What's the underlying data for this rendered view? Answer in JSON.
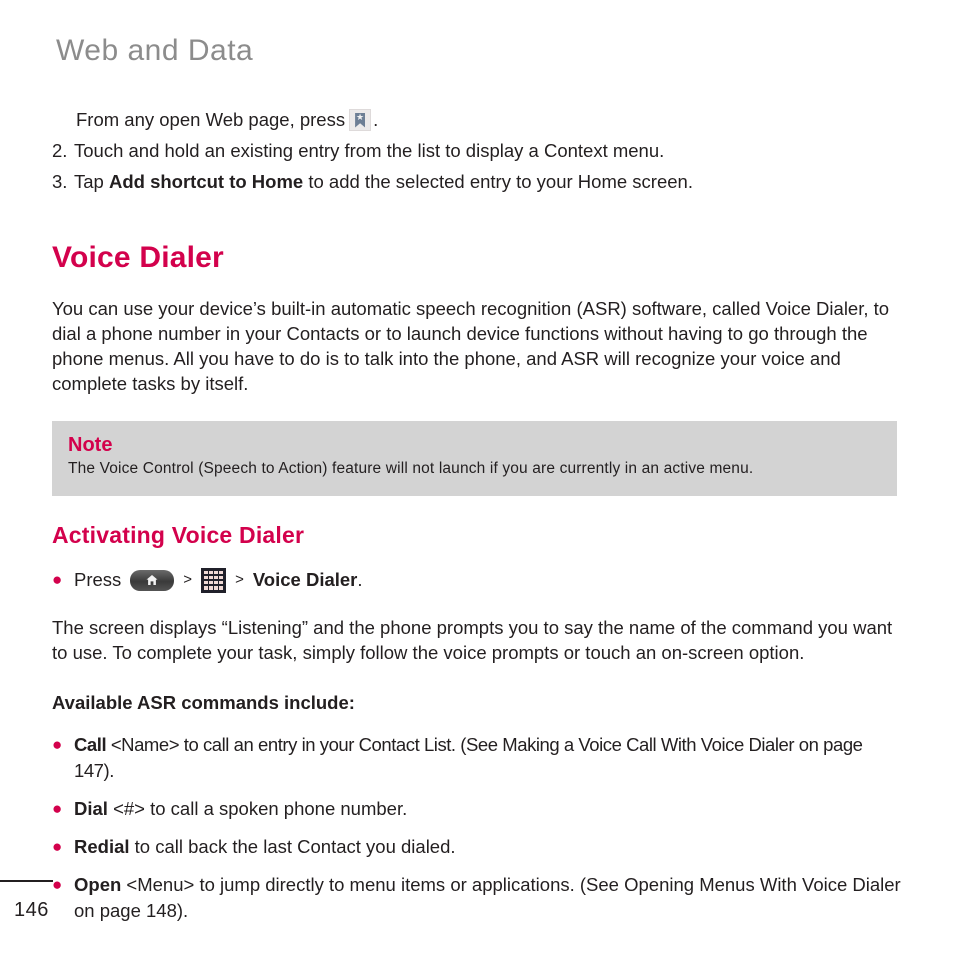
{
  "running_head": "Web and Data",
  "steps": {
    "continued_line": {
      "before_icon": "From any open Web page, press",
      "icon": "bookmark-icon",
      "after_icon": "."
    },
    "items": [
      {
        "number": "2.",
        "text": "Touch and hold an existing entry from the list to display a Context menu."
      },
      {
        "number": "3.",
        "prefix": "Tap ",
        "bold": "Add shortcut to Home",
        "suffix": " to add the selected entry to your Home screen."
      }
    ]
  },
  "voice_dialer": {
    "heading": "Voice Dialer",
    "intro": "You can use your device’s built-in automatic speech recognition (ASR) software, called Voice Dialer, to dial a phone number in your Contacts or to launch device functions without having to go through the phone menus. All you have to do is to talk into the phone, and ASR will recognize your voice and complete tasks by itself."
  },
  "note": {
    "title": "Note",
    "body": "The Voice Control (Speech to Action) feature will not launch if you are currently in an active menu."
  },
  "activating": {
    "heading": "Activating Voice Dialer",
    "press_row": {
      "label": "Press",
      "separator_1": ">",
      "separator_2": ">",
      "home_key_icon": "home-key-icon",
      "apps_grid_icon": "apps-grid-icon",
      "target_bold": "Voice Dialer",
      "target_suffix": "."
    },
    "paragraph": "The screen displays “Listening” and the phone prompts you to say the name of the command you want to use. To complete your task, simply follow the voice prompts or touch an on-screen option.",
    "commands_title": "Available ASR commands include:",
    "commands": [
      {
        "bold": "Call",
        "rest": " <Name> to call an entry in your Contact List. (See Making a Voice Call With Voice Dialer on page 147)."
      },
      {
        "bold": "Dial",
        "rest": " <#> to call a spoken phone number."
      },
      {
        "bold": "Redial",
        "rest": " to call back the last Contact you dialed."
      },
      {
        "bold": "Open",
        "rest": " <Menu> to jump directly to menu items or applications. (See Opening Menus With Voice Dialer on page 148)."
      }
    ]
  },
  "footer": {
    "page_number": "146"
  },
  "colors": {
    "accent": "#d3014c",
    "running_head": "#8c8c8c",
    "note_background": "#d3d3d3",
    "body_text": "#231f20"
  }
}
